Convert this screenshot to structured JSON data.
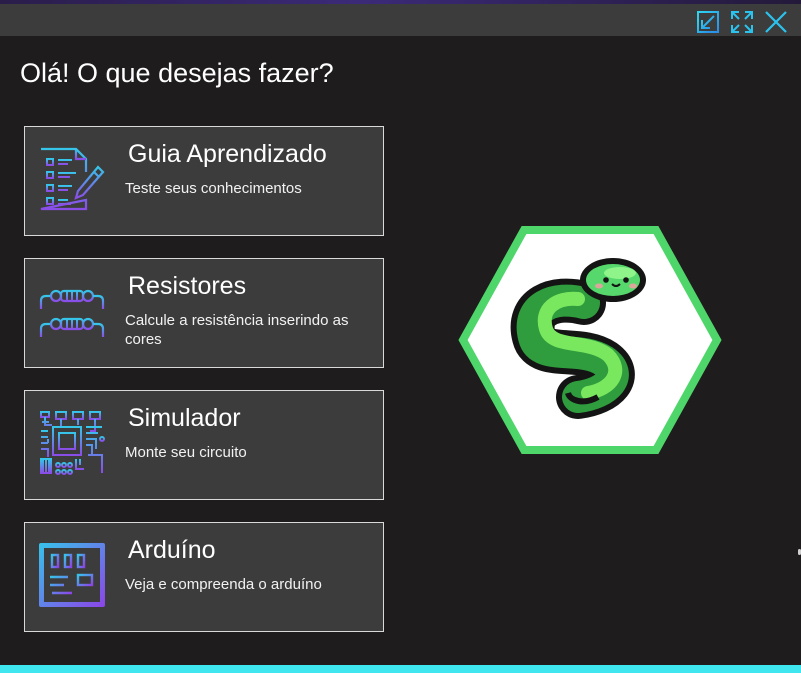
{
  "window": {
    "controls": [
      {
        "name": "minimize-window-icon"
      },
      {
        "name": "maximize-window-icon"
      },
      {
        "name": "close-window-icon"
      }
    ],
    "accent_color": "#29c7ee",
    "bottom_bar_color": "#3fe6ef"
  },
  "main": {
    "heading": "Olá! O que desejas fazer?"
  },
  "menu": {
    "items": [
      {
        "title": "Guia Aprendizado",
        "description": "Teste seus conhecimentos",
        "icon": "checklist-pencil-icon"
      },
      {
        "title": "Resistores",
        "description": "Calcule a resistência inserindo as cores",
        "icon": "resistor-icon"
      },
      {
        "title": "Simulador",
        "description": "Monte seu circuito",
        "icon": "circuit-board-icon"
      },
      {
        "title": "Arduíno",
        "description": "Veja e compreenda o arduíno",
        "icon": "arduino-chip-icon"
      }
    ]
  },
  "logo": {
    "icon": "snake-hexagon-logo",
    "border_color": "#4fd66a"
  }
}
